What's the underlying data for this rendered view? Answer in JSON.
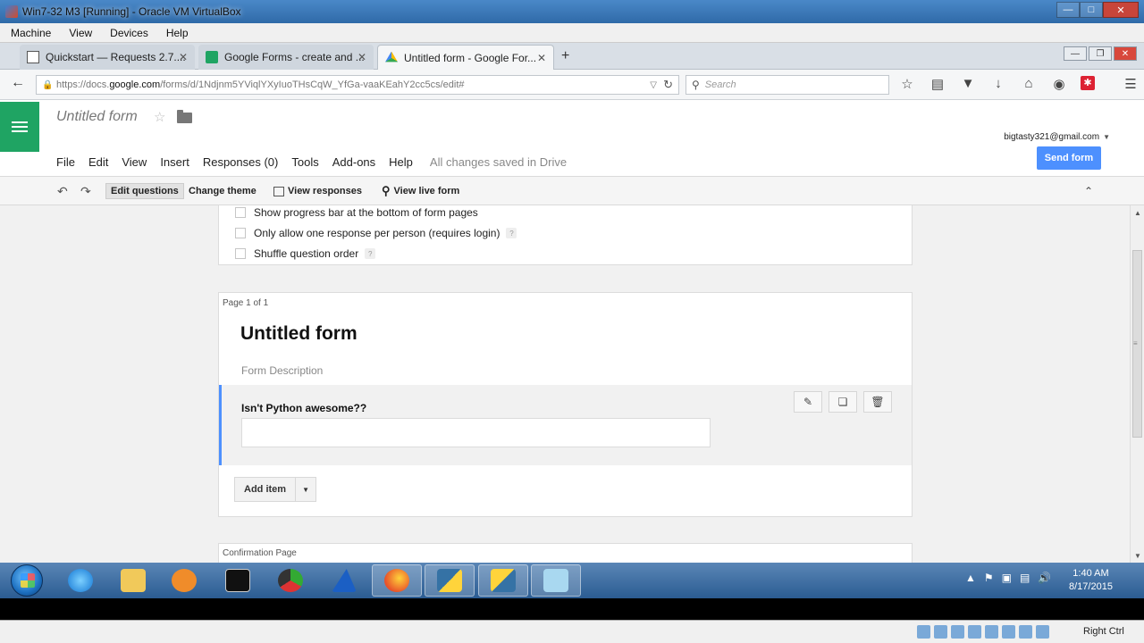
{
  "vbox": {
    "title": "Win7-32 M3 [Running] - Oracle VM VirtualBox",
    "menu": [
      "Machine",
      "View",
      "Devices",
      "Help"
    ],
    "status_host_key": "Right Ctrl"
  },
  "browser": {
    "tabs": [
      {
        "label": "Quickstart — Requests 2.7....",
        "active": false
      },
      {
        "label": "Google Forms - create and ...",
        "active": false
      },
      {
        "label": "Untitled form - Google For...",
        "active": true
      }
    ],
    "url_prefix": "https://docs.",
    "url_domain": "google.com",
    "url_suffix": "/forms/d/1Ndjnm5YViqlYXyIuoTHsCqW_YfGa-vaaKEahY2cc5cs/edit#",
    "search_placeholder": "Search"
  },
  "forms_header": {
    "doc_title": "Untitled form",
    "menu": [
      "File",
      "Edit",
      "View",
      "Insert",
      "Responses (0)",
      "Tools",
      "Add-ons",
      "Help"
    ],
    "save_status": "All changes saved in Drive",
    "account": "bigtasty321@gmail.com",
    "send_label": "Send form"
  },
  "toolbar": {
    "edit_questions": "Edit questions",
    "change_theme": "Change theme",
    "view_responses": "View responses",
    "view_live_form": "View live form"
  },
  "settings": {
    "options": [
      {
        "label": "Show progress bar at the bottom of form pages",
        "help": false,
        "checked": false
      },
      {
        "label": "Only allow one response per person (requires login)",
        "help": true,
        "checked": false
      },
      {
        "label": "Shuffle question order",
        "help": true,
        "checked": false
      }
    ],
    "help_glyph": "?"
  },
  "page": {
    "label": "Page 1 of 1",
    "form_title": "Untitled form",
    "form_description": "Form Description",
    "question_title": "Isn't Python awesome??",
    "add_item_label": "Add item"
  },
  "confirmation": {
    "label": "Confirmation Page"
  },
  "taskbar": {
    "time": "1:40 AM",
    "date": "8/17/2015"
  },
  "colors": {
    "forms_green": "#1fa463",
    "send_blue": "#4d90fe",
    "question_accent": "#4d90fe"
  }
}
